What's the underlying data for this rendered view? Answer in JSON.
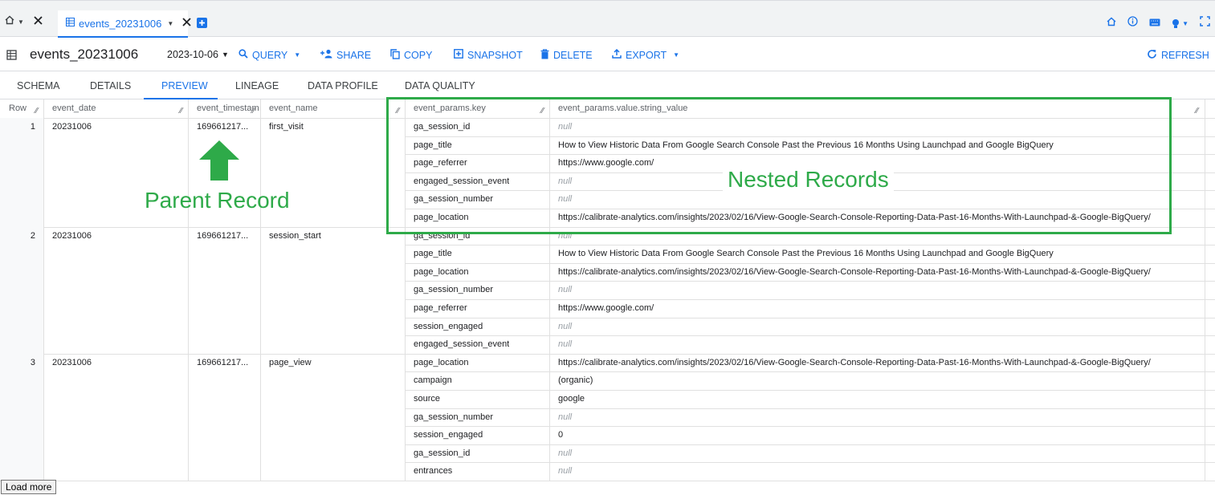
{
  "tabs": {
    "active_label": "events_20231006"
  },
  "toolbar": {
    "table_name": "events_20231006",
    "date_value": "2023-10-06",
    "query_label": "QUERY",
    "share_label": "SHARE",
    "copy_label": "COPY",
    "snapshot_label": "SNAPSHOT",
    "delete_label": "DELETE",
    "export_label": "EXPORT",
    "refresh_label": "REFRESH"
  },
  "subtabs": [
    "SCHEMA",
    "DETAILS",
    "PREVIEW",
    "LINEAGE",
    "DATA PROFILE",
    "DATA QUALITY"
  ],
  "grid": {
    "headers": {
      "row": "Row",
      "event_date": "event_date",
      "event_timestamp": "event_timestam",
      "event_name": "event_name",
      "key": "event_params.key",
      "value": "event_params.value.string_value"
    },
    "records": [
      {
        "row": "1",
        "event_date": "20231006",
        "event_timestamp": "169661217...",
        "event_name": "first_visit",
        "params": [
          {
            "key": "ga_session_id",
            "value": "null"
          },
          {
            "key": "page_title",
            "value": "How to View Historic Data From Google Search Console Past the Previous 16 Months Using Launchpad and Google BigQuery"
          },
          {
            "key": "page_referrer",
            "value": "https://www.google.com/"
          },
          {
            "key": "engaged_session_event",
            "value": "null"
          },
          {
            "key": "ga_session_number",
            "value": "null"
          },
          {
            "key": "page_location",
            "value": "https://calibrate-analytics.com/insights/2023/02/16/View-Google-Search-Console-Reporting-Data-Past-16-Months-With-Launchpad-&-Google-BigQuery/"
          }
        ]
      },
      {
        "row": "2",
        "event_date": "20231006",
        "event_timestamp": "169661217...",
        "event_name": "session_start",
        "params": [
          {
            "key": "ga_session_id",
            "value": "null"
          },
          {
            "key": "page_title",
            "value": "How to View Historic Data From Google Search Console Past the Previous 16 Months Using Launchpad and Google BigQuery"
          },
          {
            "key": "page_location",
            "value": "https://calibrate-analytics.com/insights/2023/02/16/View-Google-Search-Console-Reporting-Data-Past-16-Months-With-Launchpad-&-Google-BigQuery/"
          },
          {
            "key": "ga_session_number",
            "value": "null"
          },
          {
            "key": "page_referrer",
            "value": "https://www.google.com/"
          },
          {
            "key": "session_engaged",
            "value": "null"
          },
          {
            "key": "engaged_session_event",
            "value": "null"
          }
        ]
      },
      {
        "row": "3",
        "event_date": "20231006",
        "event_timestamp": "169661217...",
        "event_name": "page_view",
        "params": [
          {
            "key": "page_location",
            "value": "https://calibrate-analytics.com/insights/2023/02/16/View-Google-Search-Console-Reporting-Data-Past-16-Months-With-Launchpad-&-Google-BigQuery/"
          },
          {
            "key": "campaign",
            "value": "(organic)"
          },
          {
            "key": "source",
            "value": "google"
          },
          {
            "key": "ga_session_number",
            "value": "null"
          },
          {
            "key": "session_engaged",
            "value": "0"
          },
          {
            "key": "ga_session_id",
            "value": "null"
          },
          {
            "key": "entrances",
            "value": "null"
          }
        ]
      }
    ]
  },
  "annotations": {
    "nested": "Nested Records",
    "parent": "Parent Record",
    "accent_color": "#2eaa49"
  },
  "footer": {
    "load_more_label": "Load more"
  },
  "colors": {
    "accent": "#1a73e8",
    "null_text": "#9aa0a6"
  }
}
